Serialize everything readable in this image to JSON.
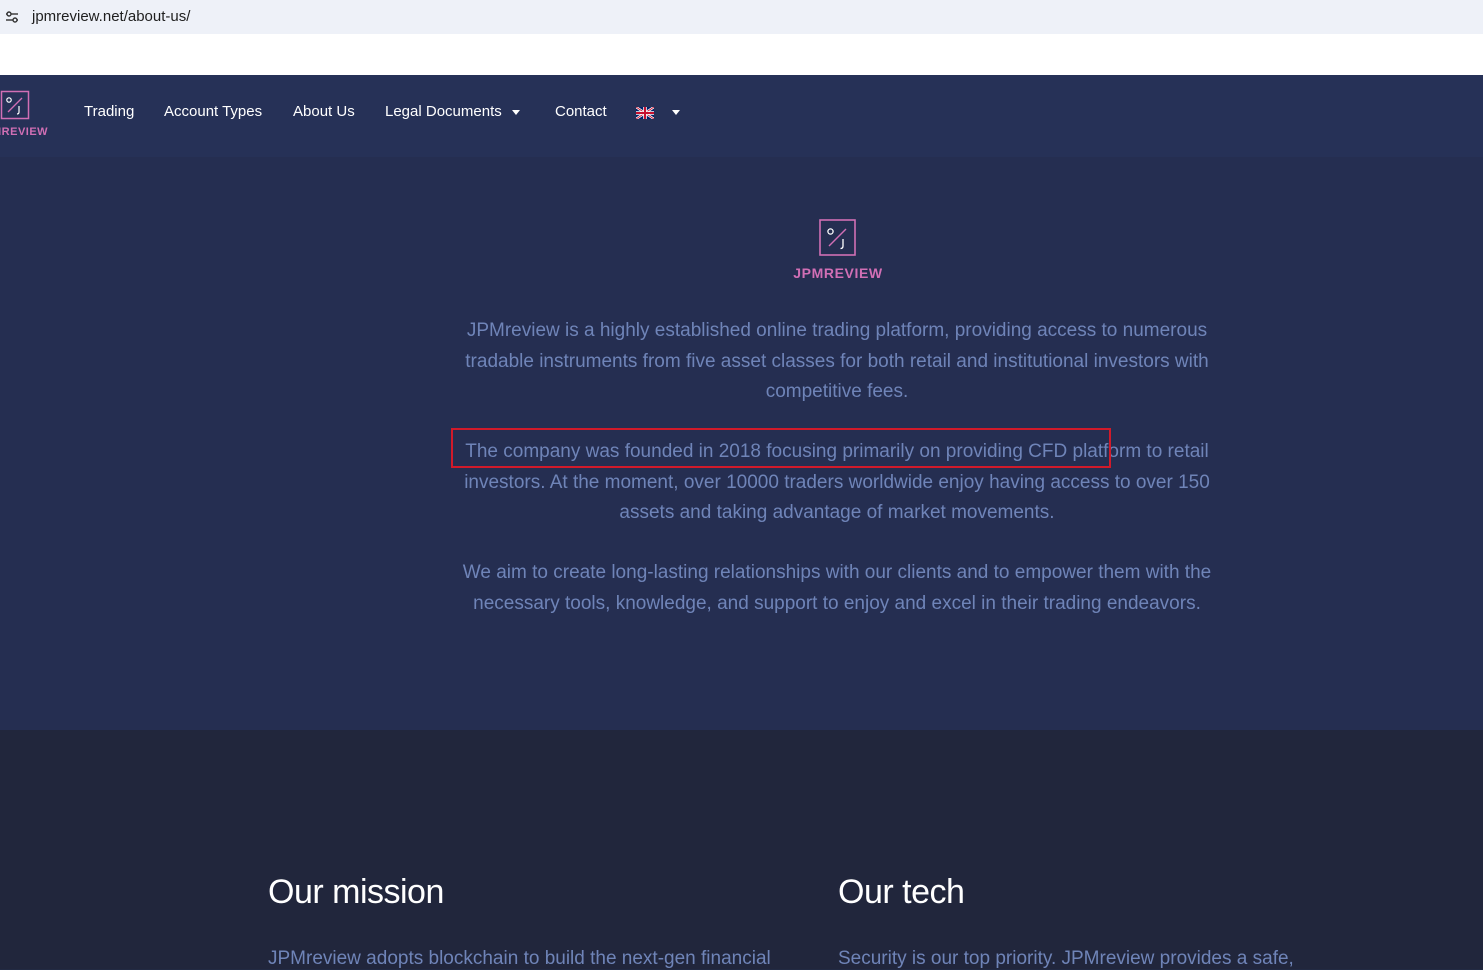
{
  "browser": {
    "url": "jpmreview.net/about-us/",
    "site_info_icon": "tune-icon"
  },
  "nav": {
    "logo_icon": "percent-logo-icon",
    "logo_text": "MREVIEW",
    "items": [
      {
        "label": "Trading"
      },
      {
        "label": "Account Types"
      },
      {
        "label": "About Us"
      },
      {
        "label": "Legal Documents",
        "has_dropdown": true
      },
      {
        "label": "Contact"
      }
    ],
    "language": {
      "flag": "uk-flag-icon",
      "has_dropdown": true
    }
  },
  "about": {
    "logo_icon": "percent-logo-icon",
    "logo_text": "JPMREVIEW",
    "paragraphs": [
      "JPMreview is a highly established online trading platform, providing access to numerous tradable instruments from five asset classes for both retail and institutional investors with competitive fees.",
      "The company was founded in 2018 focusing primarily on providing CFD platform to retail investors. At the moment, over 10000 traders worldwide enjoy having access to over 150 assets and taking advantage of market movements.",
      "We aim to create long-lasting relationships with our clients and to empower them with the necessary tools, knowledge, and support to enjoy and excel in their trading endeavors."
    ],
    "highlight_color": "#d11a2a"
  },
  "lower": {
    "mission": {
      "title": "Our mission",
      "text": "JPMreview adopts blockchain to build the next-gen financial"
    },
    "tech": {
      "title": "Our tech",
      "text": "Security is our top priority. JPMreview provides a safe,"
    }
  },
  "colors": {
    "nav_bg": "#263157",
    "about_bg": "#252e51",
    "lower_bg": "#21263c",
    "accent_pink": "#d16fb5",
    "text_blue": "#6f84b8"
  }
}
